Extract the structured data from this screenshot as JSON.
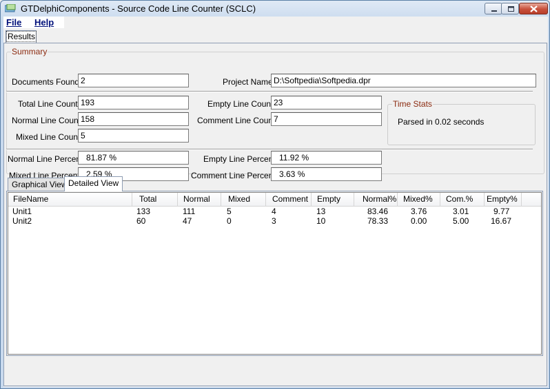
{
  "window": {
    "title": "GTDelphiComponents - Source Code Line Counter (SCLC)"
  },
  "menu": {
    "file": "File",
    "help": "Help"
  },
  "tabs": {
    "results": "Results",
    "graphical": "Graphical View",
    "detailed": "Detailed View"
  },
  "summary": {
    "group_title": "Summary",
    "documents_found_label": "Documents Found :",
    "documents_found": "2",
    "project_name_label": "Project Name:",
    "project_name": "D:\\Softpedia\\Softpedia.dpr",
    "total_line_count_label": "Total Line Count :",
    "total_line_count": "193",
    "empty_line_count_label": "Empty Line Count :",
    "empty_line_count": "23",
    "normal_line_count_label": "Normal Line Count :",
    "normal_line_count": "158",
    "comment_line_count_label": "Comment Line Count :",
    "comment_line_count": "7",
    "mixed_line_count_label": "Mixed Line Count :",
    "mixed_line_count": "5",
    "normal_line_percent_label": "Normal Line Percent:",
    "normal_line_percent": "81.87 %",
    "empty_line_percent_label": "Empty Line Percent:",
    "empty_line_percent": "11.92 %",
    "mixed_line_percent_label": "Mixed Line Percent :",
    "mixed_line_percent": "2.59 %",
    "comment_line_percent_label": "Comment Line Percent :",
    "comment_line_percent": "3.63 %"
  },
  "time_stats": {
    "group_title": "Time Stats",
    "parsed": "Parsed in 0.02 seconds"
  },
  "table": {
    "columns": [
      "FileName",
      "Total",
      "Normal",
      "Mixed",
      "Comment",
      "Empty",
      "Normal%",
      "Mixed%",
      "Com.%",
      "Empty%"
    ],
    "rows": [
      [
        "Unit1",
        "133",
        "111",
        "5",
        "4",
        "13",
        "83.46",
        "3.76",
        "3.01",
        "9.77"
      ],
      [
        "Unit2",
        "60",
        "47",
        "0",
        "3",
        "10",
        "78.33",
        "0.00",
        "5.00",
        "16.67"
      ]
    ]
  },
  "colors": {
    "group_title": "#8b2a0f",
    "menu_text": "#00107a",
    "close_button": "#c8503b"
  },
  "icons": {
    "app": "app-icon",
    "minimize": "minimize-icon",
    "maximize": "maximize-icon",
    "close": "close-icon"
  }
}
